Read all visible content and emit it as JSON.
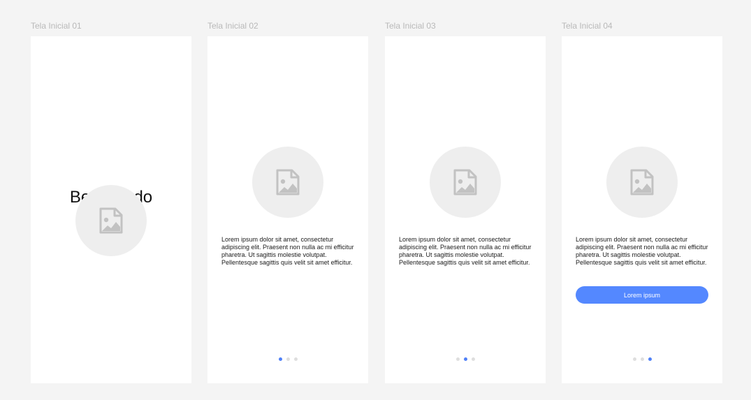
{
  "frames": [
    {
      "label": "Tela Inicial 01",
      "title": "Bem-Vindo",
      "image_icon": "image-placeholder-icon"
    },
    {
      "label": "Tela Inicial 02",
      "image_icon": "image-placeholder-icon",
      "text": "Lorem ipsum dolor sit amet, consectetur adipiscing elit. Praesent non nulla ac mi efficitur pharetra. Ut sagittis molestie volutpat. Pellentesque sagittis quis velit sit amet efficitur.",
      "pagination": {
        "count": 3,
        "active": 1
      }
    },
    {
      "label": "Tela Inicial 03",
      "image_icon": "image-placeholder-icon",
      "text": "Lorem ipsum dolor sit amet, consectetur adipiscing elit. Praesent non nulla ac mi efficitur pharetra. Ut sagittis molestie volutpat. Pellentesque sagittis quis velit sit amet efficitur.",
      "pagination": {
        "count": 3,
        "active": 2
      }
    },
    {
      "label": "Tela Inicial 04",
      "image_icon": "image-placeholder-icon",
      "text": "Lorem ipsum dolor sit amet, consectetur adipiscing elit. Praesent non nulla ac mi efficitur pharetra. Ut sagittis molestie volutpat. Pellentesque sagittis quis velit sit amet efficitur.",
      "button_label": "Lorem ipsum",
      "pagination": {
        "count": 3,
        "active": 3
      }
    }
  ],
  "colors": {
    "canvas_background": "#f4f4f4",
    "frame_background": "#ffffff",
    "frame_label": "#b9b9b9",
    "placeholder_circle": "#eeeeee",
    "placeholder_icon": "#c2c2c2",
    "accent": "#5488ff",
    "dot_active": "#4f80f7",
    "dot_inactive": "#dedede"
  }
}
